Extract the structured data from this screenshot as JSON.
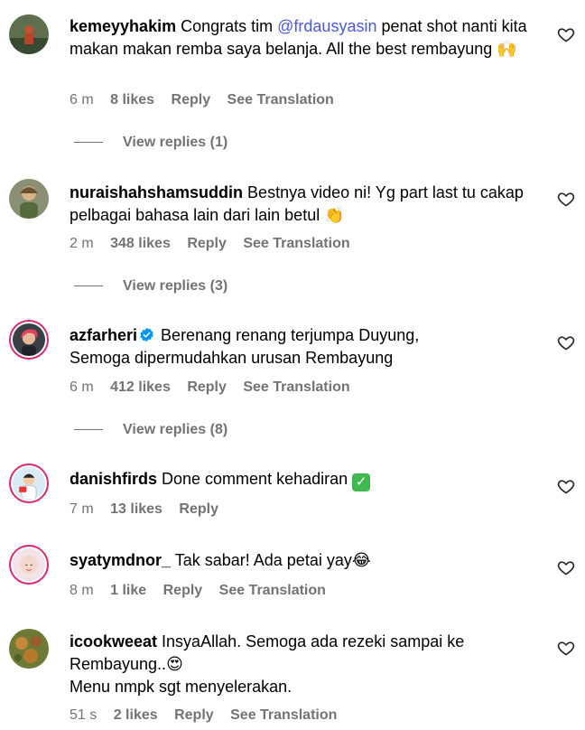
{
  "comments": [
    {
      "username": "kemeyyhakim",
      "text_before": " Congrats tim ",
      "mention": "@frdausyasin",
      "text_after": " penat shot nanti kita makan makan remba saya belanja. All the best rembayung ",
      "emoji": "🙌",
      "time": "6 m",
      "likes": "8 likes",
      "reply": "Reply",
      "translation": "See Translation",
      "view_replies": "View replies (1)"
    },
    {
      "username": "nuraishahshamsuddin",
      "text": " Bestnya video ni! Yg part last tu cakap pelbagai bahasa lain dari lain betul ",
      "emoji": "👏",
      "time": "2 m",
      "likes": "348 likes",
      "reply": "Reply",
      "translation": "See Translation",
      "view_replies": "View replies (3)"
    },
    {
      "username": "azfarheri",
      "text": " Berenang renang terjumpa Duyung,\nSemoga dipermudahkan urusan Rembayung",
      "time": "6 m",
      "likes": "412 likes",
      "reply": "Reply",
      "translation": "See Translation",
      "view_replies": "View replies (8)"
    },
    {
      "username": "danishfirds",
      "text": " Done comment kehadiran ",
      "emoji": "✓",
      "time": "7 m",
      "likes": "13 likes",
      "reply": "Reply"
    },
    {
      "username": "syatymdnor_",
      "text": " Tak sabar! Ada petai yay",
      "emoji": "😂",
      "time": "8 m",
      "likes": "1 like",
      "reply": "Reply",
      "translation": "See Translation"
    },
    {
      "username": "icookweeat",
      "text": " InsyaAllah. Semoga ada rezeki sampai ke Rembayung..",
      "emoji": "😍",
      "text2": "\nMenu nmpk sgt menyelerakan.",
      "time": "51 s",
      "likes": "2 likes",
      "reply": "Reply",
      "translation": "See Translation"
    }
  ],
  "icons": {
    "like": "heart-outline-icon",
    "verified": "verified-badge-icon"
  },
  "colors": {
    "mention": "#4b5bd7",
    "meta": "#737373",
    "verified": "#0095f6",
    "story_ring": "#d62976"
  }
}
